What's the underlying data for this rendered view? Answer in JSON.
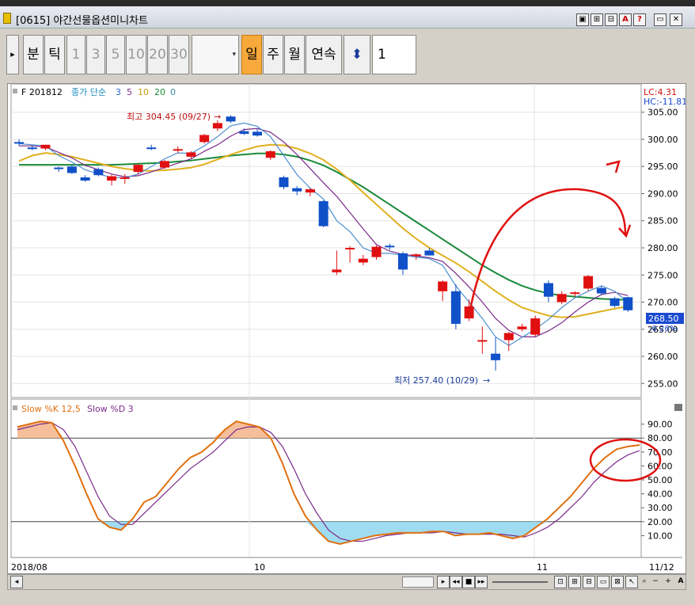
{
  "window": {
    "title": "[0615] 야간선물옵션미니차트",
    "buttons": [
      "▣",
      "⊞",
      "⊟",
      "A",
      "?",
      "▭",
      "✕"
    ]
  },
  "toolbar": {
    "expand": "▸",
    "bun": "분",
    "tik": "틱",
    "periods": [
      "1",
      "3",
      "5",
      "10",
      "20",
      "30"
    ],
    "il": "일",
    "ju": "주",
    "wol": "월",
    "yeonsok": "연속",
    "updown": "⬍",
    "count": "1"
  },
  "chart": {
    "header": "F 201812",
    "ma_label": "종가 단순",
    "ma_periods": [
      "3",
      "5",
      "10",
      "20",
      "0"
    ],
    "lc_label": "LC:4.31",
    "hc_label": "HC:-11.81",
    "y_ticks": [
      "305.00",
      "300.00",
      "295.00",
      "290.00",
      "285.00",
      "280.00",
      "275.00",
      "270.00",
      "265.00",
      "260.00",
      "255.00"
    ],
    "current_price": "268.50",
    "change_pct": "-0.26%",
    "high_label": "최고 304.45 (09/27)",
    "low_label": "최저 257.40 (10/29)",
    "colors": {
      "up": "#e01010",
      "down": "#1050c8",
      "ma3": "#4c8fd0",
      "ma5": "#7a2a8a",
      "ma10": "#e0b020",
      "ma20": "#1a8a3a"
    }
  },
  "oscillator": {
    "label_k": "Slow %K 12,5",
    "label_d": "Slow %D 3",
    "y_ticks": [
      "90.00",
      "80.00",
      "70.00",
      "60.00",
      "50.00",
      "40.00",
      "30.00",
      "20.00",
      "10.00"
    ]
  },
  "x_axis": {
    "labels": [
      "2018/08",
      "10",
      "11",
      "11/12"
    ]
  },
  "chart_data": {
    "type": "candlestick",
    "ylim": [
      253,
      307
    ],
    "candles": [
      {
        "o": 299.5,
        "h": 300,
        "l": 298.8,
        "c": 299.4
      },
      {
        "o": 298.5,
        "h": 298.8,
        "l": 298,
        "c": 298.3
      },
      {
        "o": 298.3,
        "h": 299,
        "l": 298,
        "c": 299
      },
      {
        "o": 294.8,
        "h": 295,
        "l": 294,
        "c": 294.6
      },
      {
        "o": 295,
        "h": 295.3,
        "l": 293.6,
        "c": 293.8
      },
      {
        "o": 293,
        "h": 293.4,
        "l": 292.2,
        "c": 292.4
      },
      {
        "o": 294.5,
        "h": 294.8,
        "l": 293.2,
        "c": 293.4
      },
      {
        "o": 292.4,
        "h": 293.5,
        "l": 291.5,
        "c": 293.2
      },
      {
        "o": 292.8,
        "h": 293.6,
        "l": 291.8,
        "c": 293
      },
      {
        "o": 294,
        "h": 295.5,
        "l": 293.5,
        "c": 295.3
      },
      {
        "o": 298.5,
        "h": 299,
        "l": 298,
        "c": 298.4
      },
      {
        "o": 294.8,
        "h": 296.2,
        "l": 294.5,
        "c": 296
      },
      {
        "o": 298,
        "h": 298.7,
        "l": 297.5,
        "c": 298.2
      },
      {
        "o": 296.8,
        "h": 297.8,
        "l": 296.5,
        "c": 297.6
      },
      {
        "o": 299.5,
        "h": 301,
        "l": 299.2,
        "c": 300.8
      },
      {
        "o": 302,
        "h": 303.5,
        "l": 301.5,
        "c": 303
      },
      {
        "o": 304.2,
        "h": 304.45,
        "l": 303,
        "c": 303.3
      },
      {
        "o": 301.5,
        "h": 302,
        "l": 300.8,
        "c": 301
      },
      {
        "o": 301.4,
        "h": 302,
        "l": 300.5,
        "c": 300.7
      },
      {
        "o": 296.6,
        "h": 298,
        "l": 296.2,
        "c": 297.8
      },
      {
        "o": 293,
        "h": 293.3,
        "l": 290.8,
        "c": 291.2
      },
      {
        "o": 291,
        "h": 291.4,
        "l": 289.7,
        "c": 290.4
      },
      {
        "o": 290.2,
        "h": 291,
        "l": 289.5,
        "c": 290.8
      },
      {
        "o": 288.6,
        "h": 288.8,
        "l": 283.8,
        "c": 284
      },
      {
        "o": 275.5,
        "h": 279.5,
        "l": 275,
        "c": 276
      },
      {
        "o": 279.8,
        "h": 280.3,
        "l": 277.3,
        "c": 280
      },
      {
        "o": 277.3,
        "h": 278.7,
        "l": 276.8,
        "c": 278
      },
      {
        "o": 278.3,
        "h": 280.5,
        "l": 277.8,
        "c": 280.2
      },
      {
        "o": 280.4,
        "h": 280.8,
        "l": 279.6,
        "c": 280.2
      },
      {
        "o": 279,
        "h": 279.3,
        "l": 275,
        "c": 276
      },
      {
        "o": 278.5,
        "h": 279,
        "l": 277.8,
        "c": 278.8
      },
      {
        "o": 279.5,
        "h": 280,
        "l": 278.6,
        "c": 278.6
      },
      {
        "o": 272,
        "h": 274,
        "l": 270.2,
        "c": 273.8
      },
      {
        "o": 272,
        "h": 273.3,
        "l": 265,
        "c": 266
      },
      {
        "o": 267,
        "h": 270.5,
        "l": 266.5,
        "c": 269.2
      },
      {
        "o": 263,
        "h": 265.5,
        "l": 260.5,
        "c": 263
      },
      {
        "o": 260.5,
        "h": 263.5,
        "l": 257.4,
        "c": 259.3
      },
      {
        "o": 263,
        "h": 264.5,
        "l": 261,
        "c": 264.3
      },
      {
        "o": 265,
        "h": 266,
        "l": 264.6,
        "c": 265.5
      },
      {
        "o": 264,
        "h": 267.5,
        "l": 263.7,
        "c": 267
      },
      {
        "o": 273.5,
        "h": 274,
        "l": 270,
        "c": 271
      },
      {
        "o": 270,
        "h": 272,
        "l": 269.6,
        "c": 271.5
      },
      {
        "o": 271.5,
        "h": 272,
        "l": 271,
        "c": 271.8
      },
      {
        "o": 272.5,
        "h": 275,
        "l": 272,
        "c": 274.8
      },
      {
        "o": 272.6,
        "h": 273,
        "l": 271.3,
        "c": 271.6
      },
      {
        "o": 270.7,
        "h": 271,
        "l": 269,
        "c": 269.3
      },
      {
        "o": 270.9,
        "h": 271,
        "l": 268.2,
        "c": 268.5
      }
    ],
    "ma3": [
      299.2,
      299,
      298.8,
      297,
      295.8,
      294.4,
      293.6,
      293,
      292.9,
      293.6,
      295,
      296.4,
      297.5,
      297.4,
      298.8,
      300.5,
      302.5,
      303,
      302.4,
      300.5,
      297,
      293.5,
      291,
      289,
      285,
      283,
      280,
      279,
      279,
      278.6,
      278.3,
      278,
      276.8,
      273,
      270,
      267,
      263.6,
      262,
      263.5,
      265,
      266.8,
      269,
      270.8,
      272,
      273,
      272,
      270
    ],
    "ma5": [
      298.8,
      298.8,
      298.6,
      297.6,
      296.6,
      295.2,
      294.4,
      293.6,
      293.1,
      293.3,
      294,
      294.8,
      295.6,
      296.4,
      297.8,
      299,
      300.6,
      301.8,
      302,
      301.3,
      299.5,
      297.2,
      294.6,
      292,
      289.5,
      286.5,
      283.5,
      280.6,
      279.4,
      278.8,
      278.5,
      278.2,
      277.5,
      275.3,
      272.8,
      270,
      267,
      264.8,
      263.6,
      263.6,
      264.7,
      266.2,
      268.2,
      270,
      271.4,
      271.8,
      271.2
    ],
    "ma10": [
      296,
      297,
      297.5,
      297.2,
      296.8,
      296.2,
      295.6,
      295,
      294.6,
      294.3,
      294.2,
      294.3,
      294.5,
      294.8,
      295.4,
      296.3,
      297.2,
      298,
      298.7,
      299,
      298.9,
      298.3,
      297.4,
      296.2,
      294.5,
      292.5,
      290.2,
      288,
      285.8,
      283.6,
      281.7,
      280,
      278.6,
      277.2,
      275.6,
      273.8,
      272,
      270.4,
      269,
      268.2,
      267.5,
      267.2,
      267.3,
      267.8,
      268.3,
      268.8,
      269.2
    ],
    "ma20": [
      295.3,
      295.3,
      295.3,
      295.3,
      295.3,
      295.3,
      295.3,
      295.3,
      295.4,
      295.5,
      295.6,
      295.7,
      295.9,
      296.1,
      296.4,
      296.7,
      297,
      297.2,
      297.4,
      297.4,
      297.2,
      296.8,
      296.1,
      295.2,
      294,
      292.6,
      291.2,
      289.6,
      288,
      286.4,
      284.8,
      283.2,
      281.6,
      280,
      278.4,
      276.8,
      275.4,
      274.1,
      273,
      272.2,
      271.6,
      271.2,
      271,
      270.8,
      270.6,
      270.5,
      270.4
    ],
    "slow_k": [
      88,
      90,
      92,
      91,
      78,
      60,
      40,
      22,
      16,
      14,
      22,
      34,
      38,
      48,
      58,
      66,
      70,
      77,
      86,
      92,
      90,
      88,
      80,
      62,
      40,
      24,
      14,
      6,
      4,
      6,
      8,
      10,
      11,
      12,
      12,
      12,
      13,
      13,
      10,
      11,
      11,
      12,
      10,
      8,
      10,
      16,
      22,
      30,
      38,
      48,
      58,
      66,
      72,
      74,
      75
    ],
    "slow_d": [
      86,
      88,
      90,
      91,
      86,
      74,
      56,
      38,
      24,
      18,
      18,
      26,
      34,
      42,
      50,
      58,
      64,
      70,
      78,
      86,
      88,
      88,
      84,
      74,
      58,
      40,
      26,
      14,
      8,
      6,
      6,
      8,
      10,
      11,
      12,
      12,
      12,
      13,
      12,
      11,
      11,
      11,
      11,
      10,
      9,
      12,
      16,
      22,
      30,
      38,
      48,
      56,
      63,
      68,
      71
    ]
  }
}
